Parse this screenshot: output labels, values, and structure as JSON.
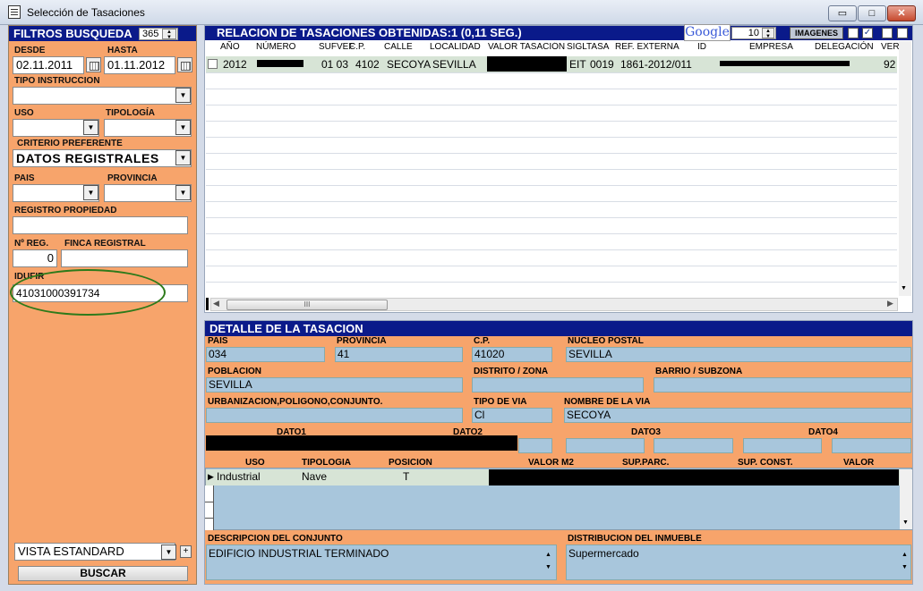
{
  "window": {
    "title": "Selección de Tasaciones",
    "min_label": "▭",
    "max_label": "□",
    "close_label": "✕"
  },
  "filters": {
    "header": "FILTROS BUSQUEDA",
    "days_value": "365",
    "desde_label": "DESDE",
    "desde_value": "02.11.2011",
    "hasta_label": "HASTA",
    "hasta_value": "01.11.2012",
    "tipo_instruccion_label": "TIPO INSTRUCCION",
    "tipo_instruccion_value": "",
    "uso_label": "USO",
    "uso_value": "",
    "tipologia_label": "TIPOLOGÍA",
    "tipologia_value": "",
    "criterio_label": "CRITERIO PREFERENTE",
    "criterio_value": "DATOS REGISTRALES",
    "pais_label": "PAIS",
    "pais_value": "",
    "provincia_label": "PROVINCIA",
    "provincia_value": "",
    "registro_label": "REGISTRO PROPIEDAD",
    "registro_value": "",
    "nreg_label": "Nº REG.",
    "nreg_value": "0",
    "finca_label": "FINCA REGISTRAL",
    "finca_value": "",
    "idufir_label": "IDUFIR",
    "idufir_value": "41031000391734",
    "vista_value": "VISTA ESTANDARD",
    "plus_label": "+",
    "buscar_label": "BUSCAR"
  },
  "results": {
    "header": "RELACION DE TASACIONES OBTENIDAS:1 (0,11 SEG.)",
    "google_label": "Google",
    "count_value": "10",
    "imagenes_label": "IMAGENES",
    "columns": [
      "AÑO",
      "NÚMERO",
      "SUFVEF",
      "C.P.",
      "CALLE",
      "LOCALIDAD",
      "VALOR TASACIÓN",
      "SIGLTASA",
      "REF. EXTERNA",
      "ID",
      "EMPRESA",
      "DELEGACIÓN",
      "VER"
    ],
    "row": {
      "anio": "2012",
      "sufvef": "01 03",
      "cp": "4102",
      "calle": "SECOYA",
      "localidad": "SEVILLA",
      "sigla": "EIT",
      "tasa": "0019",
      "ref_externa": "1861-2012/011",
      "ver": "92"
    },
    "scroll_thumb": "III"
  },
  "detail": {
    "header": "DETALLE DE LA TASACION",
    "pais_label": "PAIS",
    "pais_value": "034",
    "provincia_label": "PROVINCIA",
    "provincia_value": "41",
    "cp_label": "C.P.",
    "cp_value": "41020",
    "nucleo_label": "NUCLEO POSTAL",
    "nucleo_value": "SEVILLA",
    "poblacion_label": "POBLACION",
    "poblacion_value": "SEVILLA",
    "distrito_label": "DISTRITO / ZONA",
    "distrito_value": "",
    "barrio_label": "BARRIO / SUBZONA",
    "barrio_value": "",
    "urbanizacion_label": "URBANIZACION,POLIGONO,CONJUNTO.",
    "urbanizacion_value": "",
    "tipovia_label": "TIPO DE VIA",
    "tipovia_value": "Cl",
    "nombrevia_label": "NOMBRE DE LA VIA",
    "nombrevia_value": "SECOYA",
    "dato1_label": "DATO1",
    "dato2_label": "DATO2",
    "dato3_label": "DATO3",
    "dato4_label": "DATO4",
    "subgrid_columns": [
      "USO",
      "TIPOLOGIA",
      "POSICION",
      "VALOR M2",
      "SUP.PARC.",
      "SUP. CONST.",
      "VALOR"
    ],
    "subgrid_row": {
      "uso": "Industrial",
      "tipologia": "Nave",
      "posicion": "T"
    },
    "descripcion_label": "DESCRIPCION DEL CONJUNTO",
    "descripcion_value": "EDIFICIO INDUSTRIAL TERMINADO",
    "distribucion_label": "DISTRIBUCION DEL INMUEBLE",
    "distribucion_value": "Supermercado"
  }
}
